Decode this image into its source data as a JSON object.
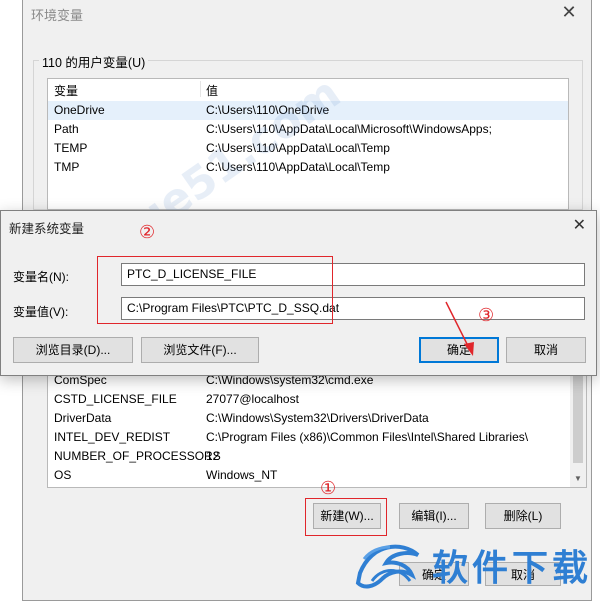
{
  "env_window": {
    "title": "环境变量",
    "user_group_label": "110 的用户变量(U)",
    "columns": [
      "变量",
      "值"
    ],
    "user_vars": [
      {
        "name": "OneDrive",
        "value": "C:\\Users\\110\\OneDrive"
      },
      {
        "name": "Path",
        "value": "C:\\Users\\110\\AppData\\Local\\Microsoft\\WindowsApps;"
      },
      {
        "name": "TEMP",
        "value": "C:\\Users\\110\\AppData\\Local\\Temp"
      },
      {
        "name": "TMP",
        "value": "C:\\Users\\110\\AppData\\Local\\Temp"
      }
    ],
    "system_vars": [
      {
        "name": "ComSpec",
        "value": "C:\\Windows\\system32\\cmd.exe"
      },
      {
        "name": "CSTD_LICENSE_FILE",
        "value": "27077@localhost"
      },
      {
        "name": "DriverData",
        "value": "C:\\Windows\\System32\\Drivers\\DriverData"
      },
      {
        "name": "INTEL_DEV_REDIST",
        "value": "C:\\Program Files (x86)\\Common Files\\Intel\\Shared Libraries\\"
      },
      {
        "name": "NUMBER_OF_PROCESSORS",
        "value": "12"
      },
      {
        "name": "OS",
        "value": "Windows_NT"
      }
    ],
    "buttons": {
      "new": "新建(W)...",
      "edit": "编辑(I)...",
      "delete": "删除(L)",
      "ok": "确定",
      "cancel": "取消"
    }
  },
  "dialog": {
    "title": "新建系统变量",
    "name_label": "变量名(N):",
    "name_value": "PTC_D_LICENSE_FILE",
    "value_label": "变量值(V):",
    "value_value": "C:\\Program Files\\PTC\\PTC_D_SSQ.dat",
    "browse_dir": "浏览目录(D)...",
    "browse_file": "浏览文件(F)...",
    "ok": "确定",
    "cancel": "取消"
  },
  "annotations": {
    "step1": "①",
    "step2": "②",
    "step3": "③"
  },
  "watermark": {
    "logo_text": "软件下载",
    "diagonal_text": "xue51.com"
  },
  "colors": {
    "annotation_red": "#e0262b",
    "selection": "#e5f0fb",
    "accent": "#0078d7",
    "watermark_blue": "#2f7fd3"
  }
}
